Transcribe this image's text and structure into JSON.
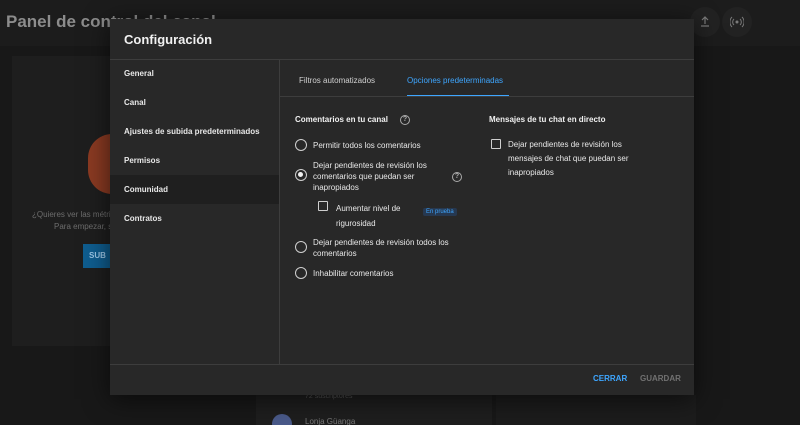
{
  "background": {
    "header_title": "Panel de control del canal",
    "upload_icon": "upload-icon",
    "live_icon": "live-broadcast-icon",
    "left_text_line1": "¿Quieres ver las métric",
    "left_text_line2": "Para empezar, s",
    "left_button": "SUB",
    "subscribers_text": "72 suscriptores",
    "user_name": "Lonja Güanga"
  },
  "dialog": {
    "title": "Configuración",
    "nav": [
      {
        "label": "General"
      },
      {
        "label": "Canal"
      },
      {
        "label": "Ajustes de subida predeterminados"
      },
      {
        "label": "Permisos"
      },
      {
        "label": "Comunidad",
        "active": true
      },
      {
        "label": "Contratos"
      }
    ],
    "tabs": [
      {
        "label": "Filtros automatizados"
      },
      {
        "label": "Opciones predeterminadas",
        "active": true
      }
    ],
    "comments": {
      "title": "Comentarios en tu canal",
      "help_icon": "help-icon",
      "options": [
        {
          "label": "Permitir todos los comentarios",
          "selected": false
        },
        {
          "label": "Dejar pendientes de revisión los comentarios que puedan ser inapropiados",
          "selected": true
        },
        {
          "label": "Dejar pendientes de revisión todos los comentarios",
          "selected": false
        },
        {
          "label": "Inhabilitar comentarios",
          "selected": false
        }
      ],
      "increase_strictness_label": "Aumentar nivel de rigurosidad",
      "increase_strictness_checked": false,
      "beta_badge": "En prueba"
    },
    "live_chat": {
      "title": "Mensajes de tu chat en directo",
      "checkbox_label": "Dejar pendientes de revisión los mensajes de chat que puedan ser inapropiados",
      "checked": false
    },
    "footer": {
      "close_label": "CERRAR",
      "save_label": "GUARDAR"
    }
  },
  "colors": {
    "accent": "#3ea6ff",
    "dialog_bg": "#282828",
    "page_bg": "#181818"
  }
}
